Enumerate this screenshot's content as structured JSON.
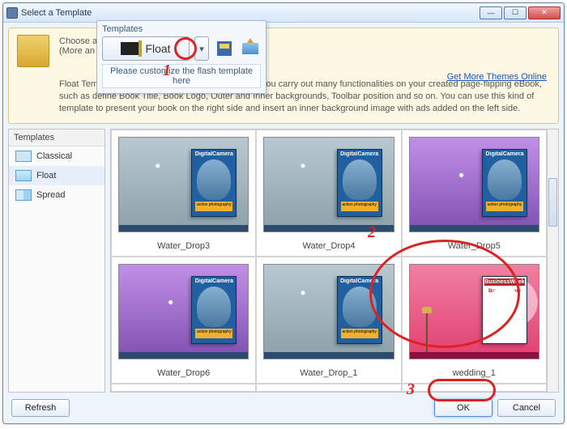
{
  "window": {
    "title": "Select a Template",
    "min": "—",
    "max": "☐",
    "close": "✕"
  },
  "info": {
    "choose": "Choose a",
    "more": "(More an",
    "link": "Get More Themes Online",
    "desc": "Float Template is the most flexible template to help you carry out many functionalities on your created page-flipping eBook, such as define Book Title, Book Logo, Outer and Inner backgrounds, Toolbar position and so on. You can use this kind of template to present your book on the right side and insert an inner background image with ads added on the left side."
  },
  "popup": {
    "title": "Templates",
    "button": "Float",
    "dropdown": "▾",
    "hint": "Please customize the flash template here"
  },
  "sidebar": {
    "title": "Templates",
    "items": [
      {
        "label": "Classical"
      },
      {
        "label": "Float"
      },
      {
        "label": "Spread"
      }
    ]
  },
  "thumbs": [
    {
      "caption": "Water_Drop3",
      "bg": "water"
    },
    {
      "caption": "Water_Drop4",
      "bg": "water"
    },
    {
      "caption": "Water_Drop5",
      "bg": "purple"
    },
    {
      "caption": "Water_Drop6",
      "bg": "purple"
    },
    {
      "caption": "Water_Drop_1",
      "bg": "water"
    },
    {
      "caption": "wedding_1",
      "bg": "pink"
    }
  ],
  "mag_strip": "action photography",
  "bweek_strip": "Buyer Beware",
  "buttons": {
    "refresh": "Refresh",
    "ok": "OK",
    "cancel": "Cancel"
  },
  "annotations": {
    "n1": "1",
    "n2": "2",
    "n3": "3"
  }
}
